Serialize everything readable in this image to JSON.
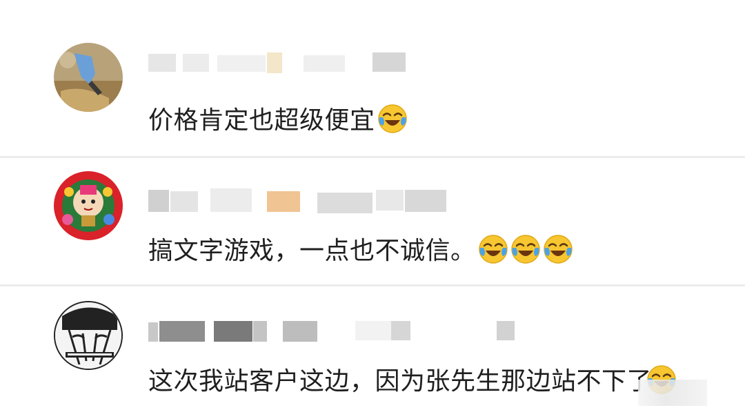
{
  "comments": [
    {
      "text": "价格肯定也超级便宜",
      "emoji": "laugh-cry-emoji",
      "emoji_count": 1
    },
    {
      "text": "搞文字游戏，一点也不诚信。",
      "emoji": "laugh-cry-emoji",
      "emoji_count": 3
    },
    {
      "text": "这次我站客户这边，因为张先生那边站不下了",
      "emoji": "laugh-cry-emoji",
      "emoji_count": 1
    }
  ],
  "colors": {
    "text": "#1f1f1f",
    "divider": "#ececec",
    "emoji_face": "#f7c631",
    "emoji_tear": "#4aa3e8"
  }
}
